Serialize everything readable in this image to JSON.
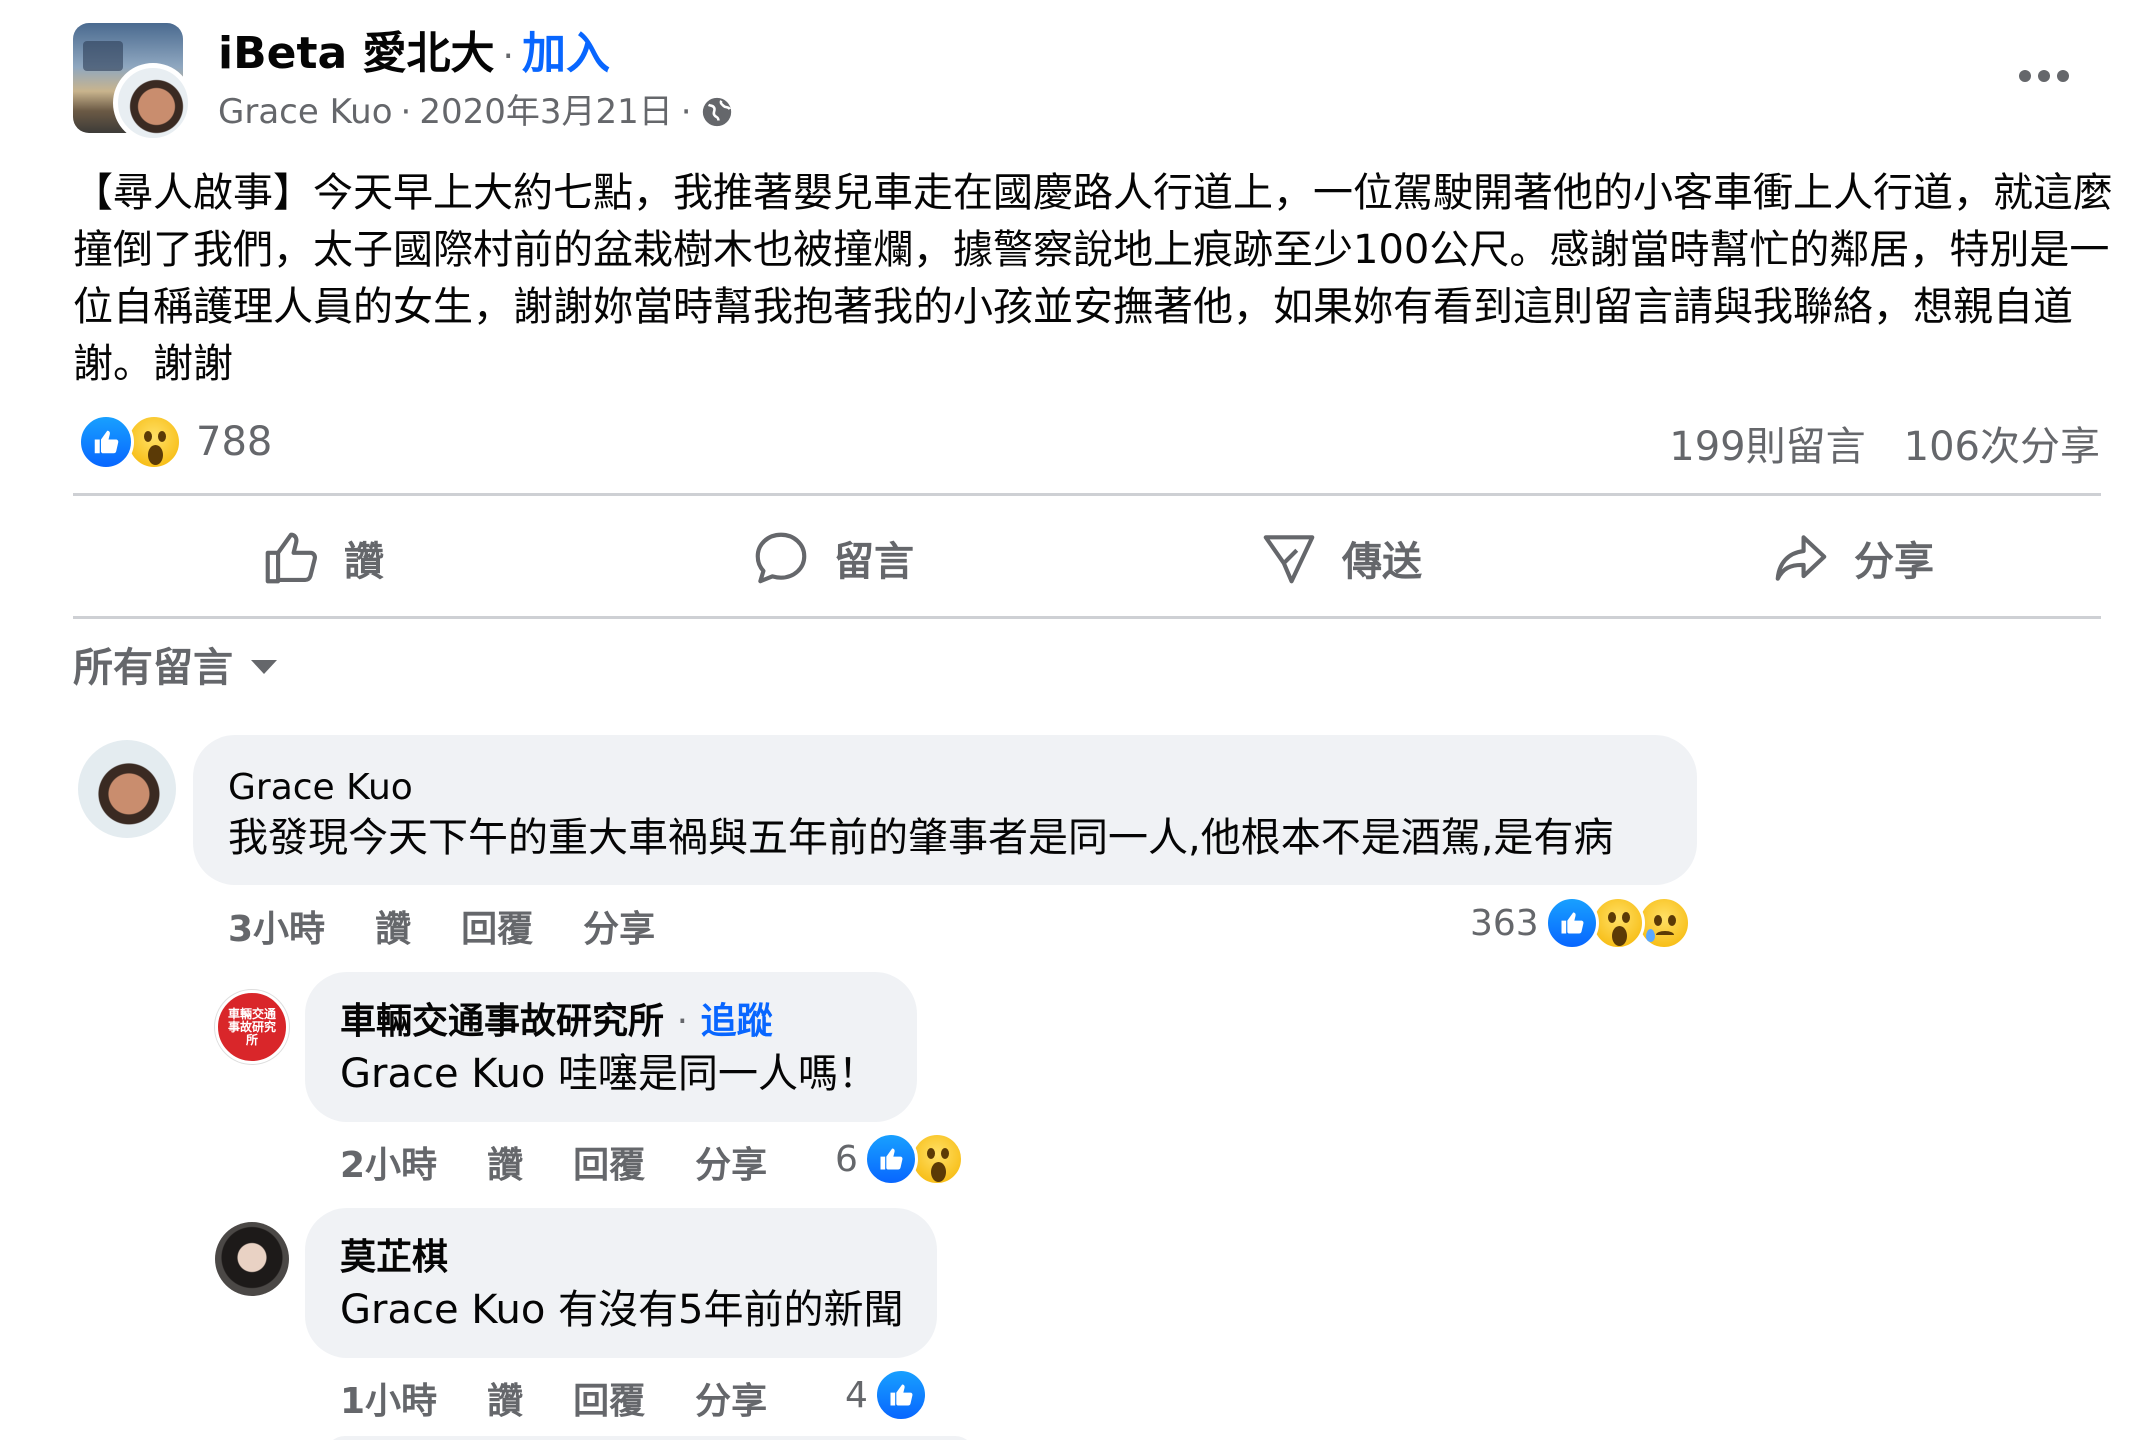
{
  "post": {
    "group_name": "iBeta 愛北大",
    "separator": "·",
    "join_label": "加入",
    "author": "Grace Kuo",
    "date": "2020年3月21日",
    "body": "【尋人啟事】今天早上大約七點，我推著嬰兒車走在國慶路人行道上，一位駕駛開著他的小客車衝上人行道，就這麼撞倒了我們，太子國際村前的盆栽樹木也被撞爛，據警察說地上痕跡至少100公尺。感謝當時幫忙的鄰居，特別是一位自稱護理人員的女生，謝謝妳當時幫我抱著我的小孩並安撫著他，如果妳有看到這則留言請與我聯絡，想親自道謝。謝謝",
    "reaction_count": "788",
    "comment_count": "199則留言",
    "share_count": "106次分享"
  },
  "actions": {
    "like": "讚",
    "comment": "留言",
    "send": "傳送",
    "share": "分享"
  },
  "filter": {
    "label": "所有留言"
  },
  "comments": [
    {
      "name": "Grace Kuo",
      "text": "我發現今天下午的重大車禍與五年前的肇事者是同一人,他根本不是酒駕,是有病",
      "time": "3小時",
      "like": "讚",
      "reply": "回覆",
      "share": "分享",
      "reactions": "363"
    },
    {
      "name": "車輛交通事故研究所",
      "follow": "追蹤",
      "separator": "·",
      "text": "Grace Kuo 哇噻是同一人嗎！",
      "time": "2小時",
      "like": "讚",
      "reply": "回覆",
      "share": "分享",
      "reactions": "6",
      "avatar_text": "車輛交通事故研究所"
    },
    {
      "name": "莫芷棋",
      "text": "Grace Kuo 有沒有5年前的新聞",
      "time": "1小時",
      "like": "讚",
      "reply": "回覆",
      "share": "分享",
      "reactions": "4"
    }
  ],
  "colors": {
    "accent": "#0866ff",
    "secondary_text": "#65676b",
    "bubble": "#f0f2f5",
    "divider": "#ced0d4"
  },
  "icons": [
    "globe-icon",
    "more-icon",
    "like-icon",
    "comment-icon",
    "send-icon",
    "share-icon",
    "caret-down-icon",
    "like-reaction-icon",
    "wow-reaction-icon",
    "sad-reaction-icon"
  ]
}
